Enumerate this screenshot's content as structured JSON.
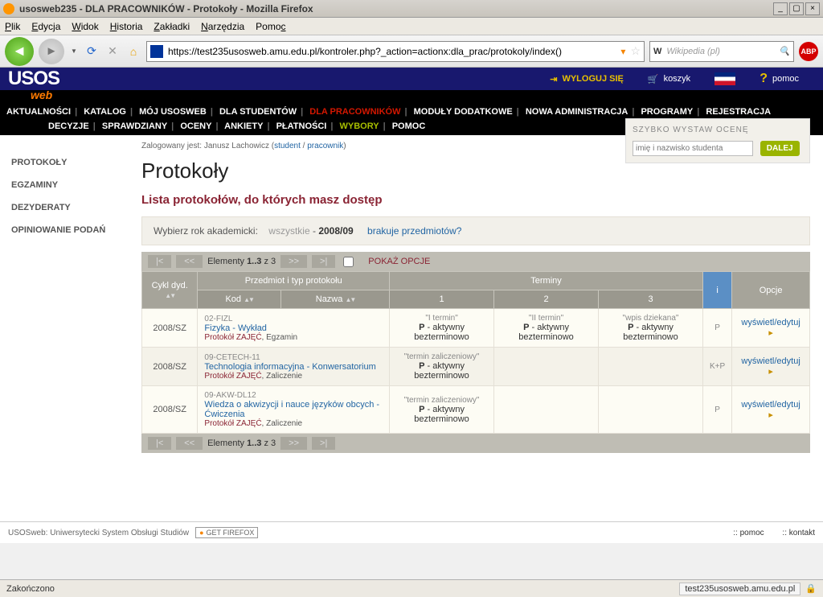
{
  "window": {
    "title": "usosweb235 - DLA PRACOWNIKÓW - Protokoły - Mozilla Firefox"
  },
  "menubar": {
    "items": [
      "Plik",
      "Edycja",
      "Widok",
      "Historia",
      "Zakładki",
      "Narzędzia",
      "Pomoc"
    ]
  },
  "toolbar": {
    "url": "https://test235usosweb.amu.edu.pl/kontroler.php?_action=actionx:dla_prac/protokoly/index()",
    "search_engine": "W",
    "search_placeholder": "Wikipedia (pl)"
  },
  "usos": {
    "logo": "USOS",
    "logo_sub": "web",
    "logout": "WYLOGUJ SIĘ",
    "cart": "koszyk",
    "help": "pomoc"
  },
  "mainnav": [
    "AKTUALNOŚCI",
    "KATALOG",
    "MÓJ USOSWEB",
    "DLA STUDENTÓW",
    "DLA PRACOWNIKÓW",
    "MODUŁY DODATKOWE",
    "NOWA ADMINISTRACJA",
    "PROGRAMY",
    "REJESTRACJA"
  ],
  "mainnav_active": 4,
  "subnav": [
    "DECYZJE",
    "SPRAWDZIANY",
    "OCENY",
    "ANKIETY",
    "PŁATNOŚCI",
    "WYBORY",
    "POMOC"
  ],
  "sidebar": [
    "PROTOKOŁY",
    "EGZAMINY",
    "DEZYDERATY",
    "OPINIOWANIE PODAŃ"
  ],
  "login_line": {
    "prefix": "Zalogowany jest:  Janusz Lachowicz (",
    "link1": "student",
    "sep": " / ",
    "link2": "pracownik",
    "suffix": ")"
  },
  "page": {
    "title": "Protokoły",
    "subtitle": "Lista protokołów, do których masz dostęp"
  },
  "gradebox": {
    "label": "SZYBKO WYSTAW OCENĘ",
    "placeholder": "imię i nazwisko studenta",
    "button": "DALEJ"
  },
  "yearselect": {
    "label": "Wybierz rok akademicki:",
    "all": "wszystkie",
    "dash": " - ",
    "current": "2008/09",
    "missing": "brakuje przedmiotów?"
  },
  "pager": {
    "elements_prefix": "Elementy ",
    "range": "1..3",
    "of": " z 3",
    "show_opts": "POKAŻ OPCJE"
  },
  "table": {
    "headers": {
      "cycle": "Cykl dyd.",
      "subject_group": "Przedmiot i typ protokołu",
      "kod": "Kod",
      "nazwa": "Nazwa",
      "terminy": "Terminy",
      "t1": "1",
      "t2": "2",
      "t3": "3",
      "info": "i",
      "opcje": "Opcje"
    },
    "rows": [
      {
        "cycle": "2008/SZ",
        "code": "02-FIZL",
        "name": "Fizyka - Wykład",
        "ptype_label": "Protokół ZAJĘĆ",
        "ptype_extra": ", Egzamin",
        "terms": [
          {
            "label": "\"I termin\"",
            "status": "P - aktywny bezterminowo"
          },
          {
            "label": "\"II termin\"",
            "status": "P - aktywny bezterminowo"
          },
          {
            "label": "\"wpis dziekana\"",
            "status": "P - aktywny bezterminowo"
          }
        ],
        "info": "P",
        "action": "wyświetl/edytuj"
      },
      {
        "cycle": "2008/SZ",
        "code": "09-CETECH-11",
        "name": "Technologia informacyjna - Konwersatorium",
        "ptype_label": "Protokół ZAJĘĆ",
        "ptype_extra": ", Zaliczenie",
        "terms": [
          {
            "label": "\"termin zaliczeniowy\"",
            "status": "P - aktywny bezterminowo"
          },
          {
            "label": "",
            "status": ""
          },
          {
            "label": "",
            "status": ""
          }
        ],
        "info": "K+P",
        "action": "wyświetl/edytuj"
      },
      {
        "cycle": "2008/SZ",
        "code": "09-AKW-DL12",
        "name": "Wiedza o akwizycji i nauce języków obcych - Ćwiczenia",
        "ptype_label": "Protokół ZAJĘĆ",
        "ptype_extra": ", Zaliczenie",
        "terms": [
          {
            "label": "\"termin zaliczeniowy\"",
            "status": "P - aktywny bezterminowo"
          },
          {
            "label": "",
            "status": ""
          },
          {
            "label": "",
            "status": ""
          }
        ],
        "info": "P",
        "action": "wyświetl/edytuj"
      }
    ]
  },
  "footer": {
    "text": "USOSweb: Uniwersytecki System Obsługi Studiów",
    "getfirefox": "GET FIREFOX",
    "pomoc": ":: pomoc",
    "kontakt": ":: kontakt"
  },
  "statusbar": {
    "status": "Zakończono",
    "host": "test235usosweb.amu.edu.pl"
  }
}
